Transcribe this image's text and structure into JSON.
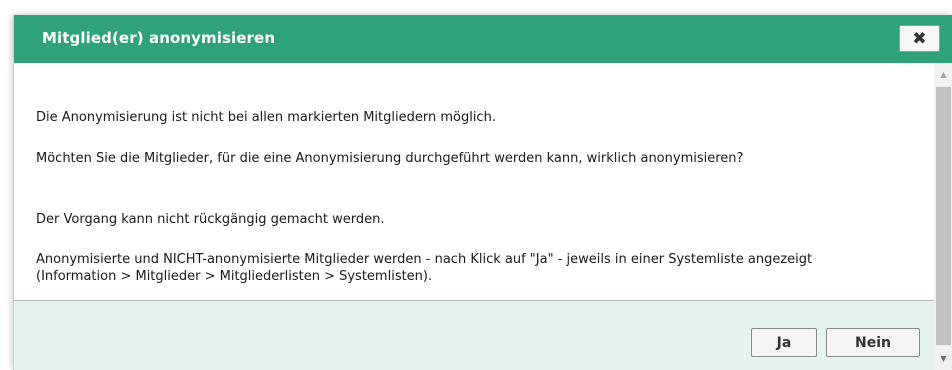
{
  "dialog": {
    "title": "Mitglied(er) anonymisieren",
    "close_symbol": "✖",
    "paragraphs": [
      "Die Anonymisierung ist nicht bei allen markierten Mitgliedern möglich.",
      "Möchten Sie die Mitglieder, für die eine Anonymisierung durchgeführt werden kann, wirklich anonymisieren?",
      "Der Vorgang kann nicht rückgängig gemacht werden.",
      "Anonymisierte und NICHT-anonymisierte Mitglieder werden - nach Klick auf \"Ja\" - jeweils in einer Systemliste angezeigt (Information > Mitglieder > Mitgliederlisten > Systemlisten)."
    ],
    "buttons": {
      "yes": "Ja",
      "no": "Nein"
    }
  },
  "scrollbar": {
    "up_symbol": "▲",
    "down_symbol": "▼"
  },
  "colors": {
    "titlebar": "#2fa27a",
    "footer": "#e4f3ed"
  }
}
